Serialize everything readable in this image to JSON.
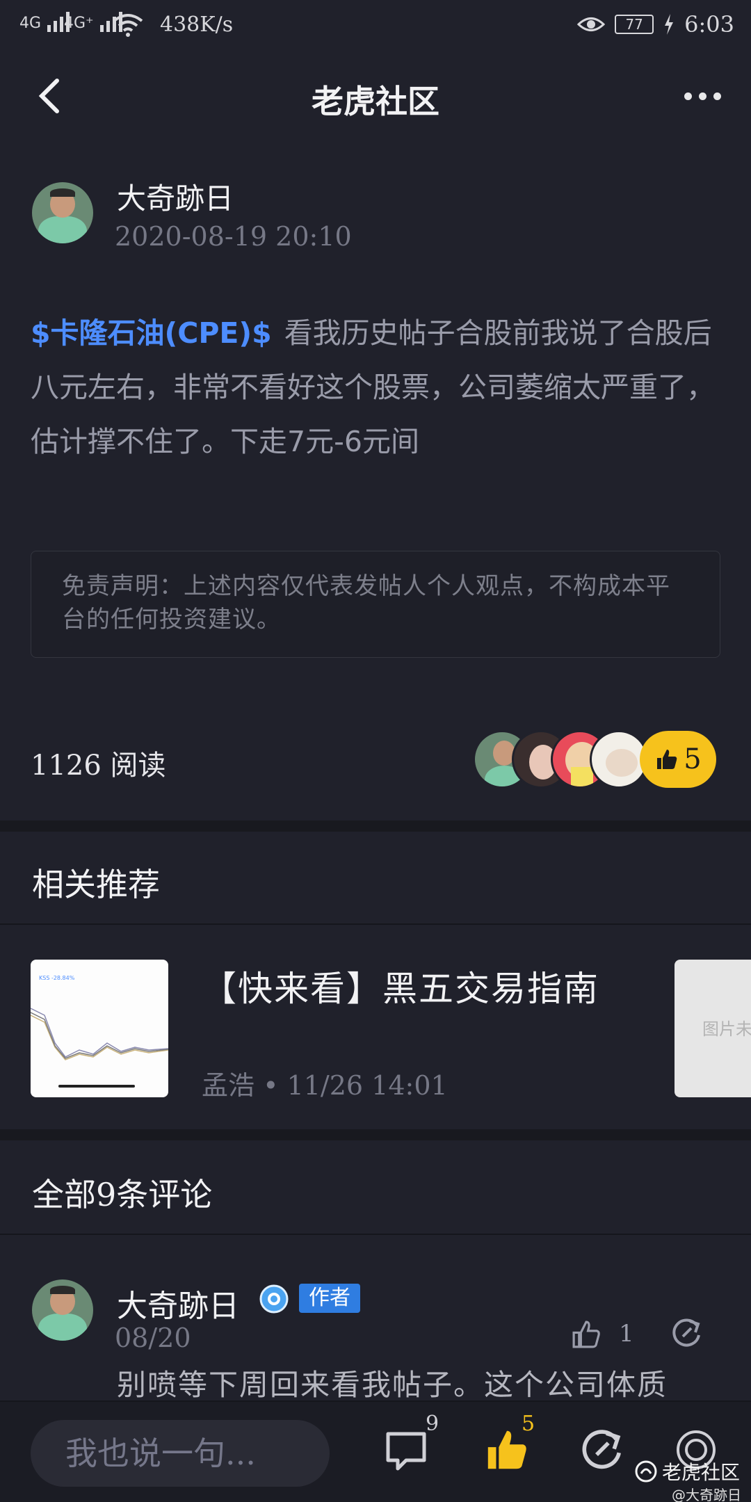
{
  "status_bar": {
    "signal1": "4G",
    "signal2": "4G⁺",
    "net_speed": "438K/s",
    "battery": "77",
    "time": "6:03"
  },
  "header": {
    "title": "老虎社区"
  },
  "post": {
    "author_name": "大奇跡日",
    "timestamp": "2020-08-19 20:10",
    "ticker": "$卡隆石油(CPE)$",
    "body": "看我历史帖子合股前我说了合股后八元左右，非常不看好这个股票，公司萎缩太严重了，估计撑不住了。下走7元-6元间",
    "disclaimer": "免责声明：上述内容仅代表发帖人个人观点，不构成本平台的任何投资建议。",
    "reads": "1126 阅读",
    "like_count": "5"
  },
  "recommend": {
    "section_title": "相关推荐",
    "item": {
      "title": "【快来看】黑五交易指南",
      "meta": "孟浩 • 11/26 14:01",
      "thumb_label": "KSS -28.84%",
      "next_placeholder": "图片未"
    }
  },
  "comments": {
    "section_title": "全部9条评论",
    "first": {
      "name": "大奇跡日",
      "tag": "作者",
      "date": "08/20",
      "like_count": "1",
      "text": "别喷等下周回来看我帖子。这个公司体质"
    }
  },
  "bottom_bar": {
    "input_placeholder": "我也说一句...",
    "comment_count": "9",
    "like_count": "5",
    "watermark": "老虎社区",
    "watermark_user": "@大奇跡日"
  },
  "colors": {
    "background": "#20212b",
    "accent_blue": "#4d8dff",
    "like_yellow": "#f6c21c"
  }
}
